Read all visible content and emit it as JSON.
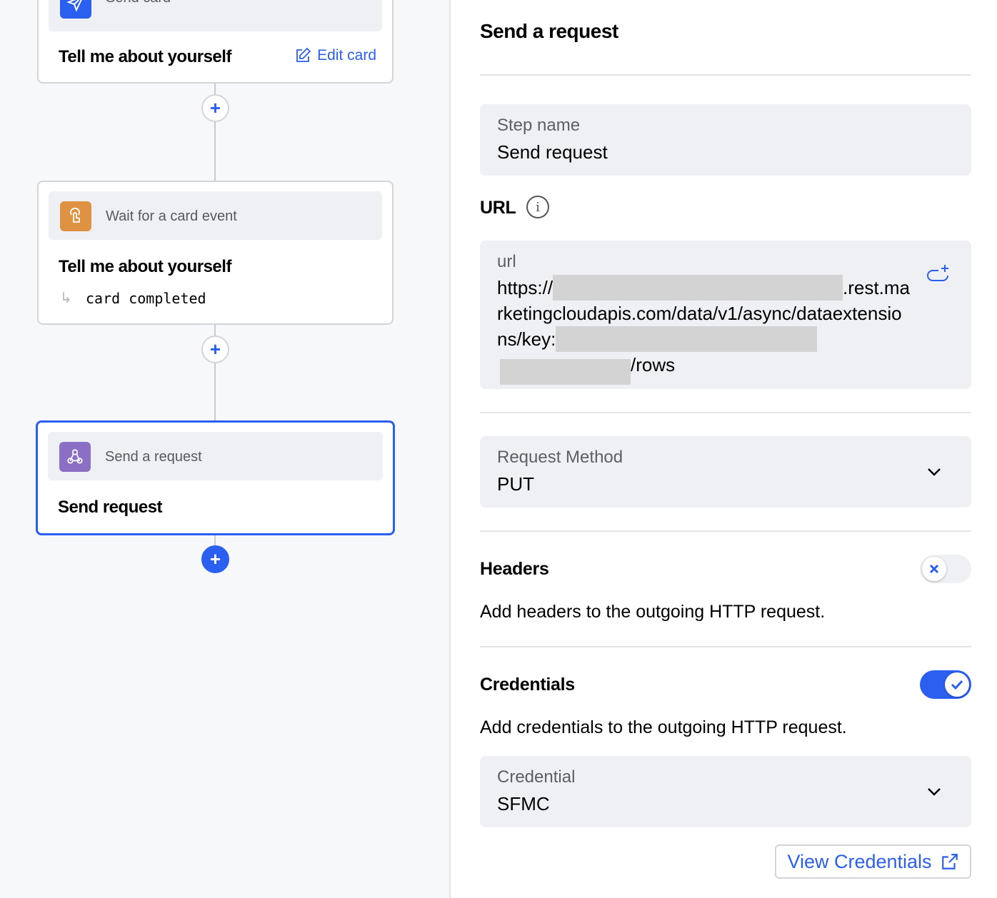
{
  "flow": {
    "cards": [
      {
        "type_label": "Send card",
        "title": "Tell me about yourself",
        "edit_label": "Edit card",
        "icon": "paper-plane-icon",
        "color": "#2b5ff0"
      },
      {
        "type_label": "Wait for a card event",
        "title": "Tell me about yourself",
        "event": "card completed",
        "icon": "hand-pointer-icon",
        "color": "#df9342"
      },
      {
        "type_label": "Send a request",
        "title": "Send request",
        "icon": "webhook-icon",
        "color": "#8a6fc4"
      }
    ],
    "add_label": "+"
  },
  "panel": {
    "title": "Send a request",
    "step_name": {
      "label": "Step name",
      "value": "Send request"
    },
    "url_heading": "URL",
    "url": {
      "label": "url",
      "line1_start": "https://",
      "line1_end": ".rest.ma",
      "line2": "rketingcloudapis.com/data/v1/async/dataextensio",
      "line3_start": "ns/key:",
      "line4_end": "/rows"
    },
    "method": {
      "label": "Request Method",
      "value": "PUT"
    },
    "headers": {
      "title": "Headers",
      "description": "Add headers to the outgoing HTTP request.",
      "enabled": false
    },
    "credentials": {
      "title": "Credentials",
      "description": "Add credentials to the outgoing HTTP request.",
      "enabled": true
    },
    "credential": {
      "label": "Credential",
      "value": "SFMC"
    },
    "view_credentials": "View Credentials"
  },
  "colors": {
    "accent": "#2b5ff0"
  }
}
